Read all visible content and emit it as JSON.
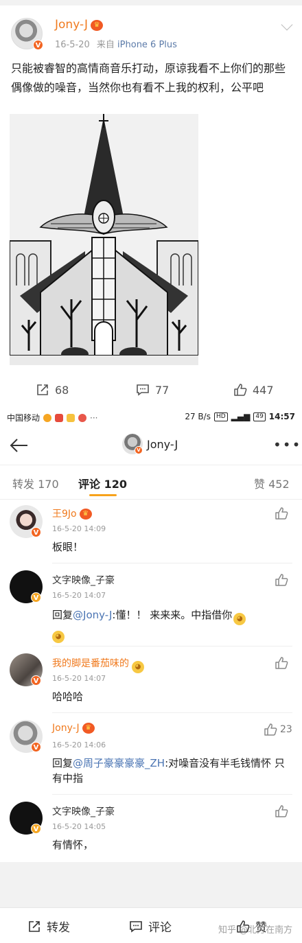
{
  "post": {
    "author": "Jony-J",
    "date": "16-5-20",
    "source_prefix": "来自",
    "source": "iPhone 6 Plus",
    "text": "只能被睿智的高情商音乐打动，原谅我看不上你们的那些偶像做的噪音，当然你也有看不上我的权利，公平吧",
    "repost_count": "68",
    "comment_count": "77",
    "like_count": "447"
  },
  "statusbar": {
    "carrier": "中国移动",
    "speed": "27 B/s",
    "battery": "49",
    "time": "14:57"
  },
  "nav": {
    "title": "Jony-J"
  },
  "tabs": {
    "repost": "转发 170",
    "comment": "评论 120",
    "like": "赞 452"
  },
  "comments": [
    {
      "name": "王9Jo",
      "time": "16-5-20 14:09",
      "text": "板眼！",
      "likes": ""
    },
    {
      "name": "文字映像_子豪",
      "time": "16-5-20 14:07",
      "reply_prefix": "回复",
      "mention": "@Jony-J",
      "text": ":懂！！ 来来来。中指借你",
      "likes": ""
    },
    {
      "name": "我的脚是番茄味的",
      "time": "16-5-20 14:07",
      "text": "哈哈哈",
      "likes": ""
    },
    {
      "name": "Jony-J",
      "time": "16-5-20 14:06",
      "reply_prefix": "回复",
      "mention": "@周子豪豪豪豪_ZH",
      "text": ":对噪音没有半毛钱情怀 只有中指",
      "likes": "23"
    },
    {
      "name": "文字映像_子豪",
      "time": "16-5-20 14:05",
      "text": "有情怀，",
      "likes": ""
    }
  ],
  "bottombar": {
    "repost": "转发",
    "comment": "评论",
    "like": "赞"
  },
  "watermark": "知乎 @北方在南方",
  "icons": [
    "repost-icon",
    "comment-icon",
    "like-icon",
    "back-arrow-icon",
    "more-icon",
    "chevron-down-icon",
    "crown-icon",
    "verified-badge-icon"
  ],
  "colors": {
    "accent": "#f7a21b",
    "name_orange": "#f07a1e",
    "mention_blue": "#4a74b3"
  }
}
